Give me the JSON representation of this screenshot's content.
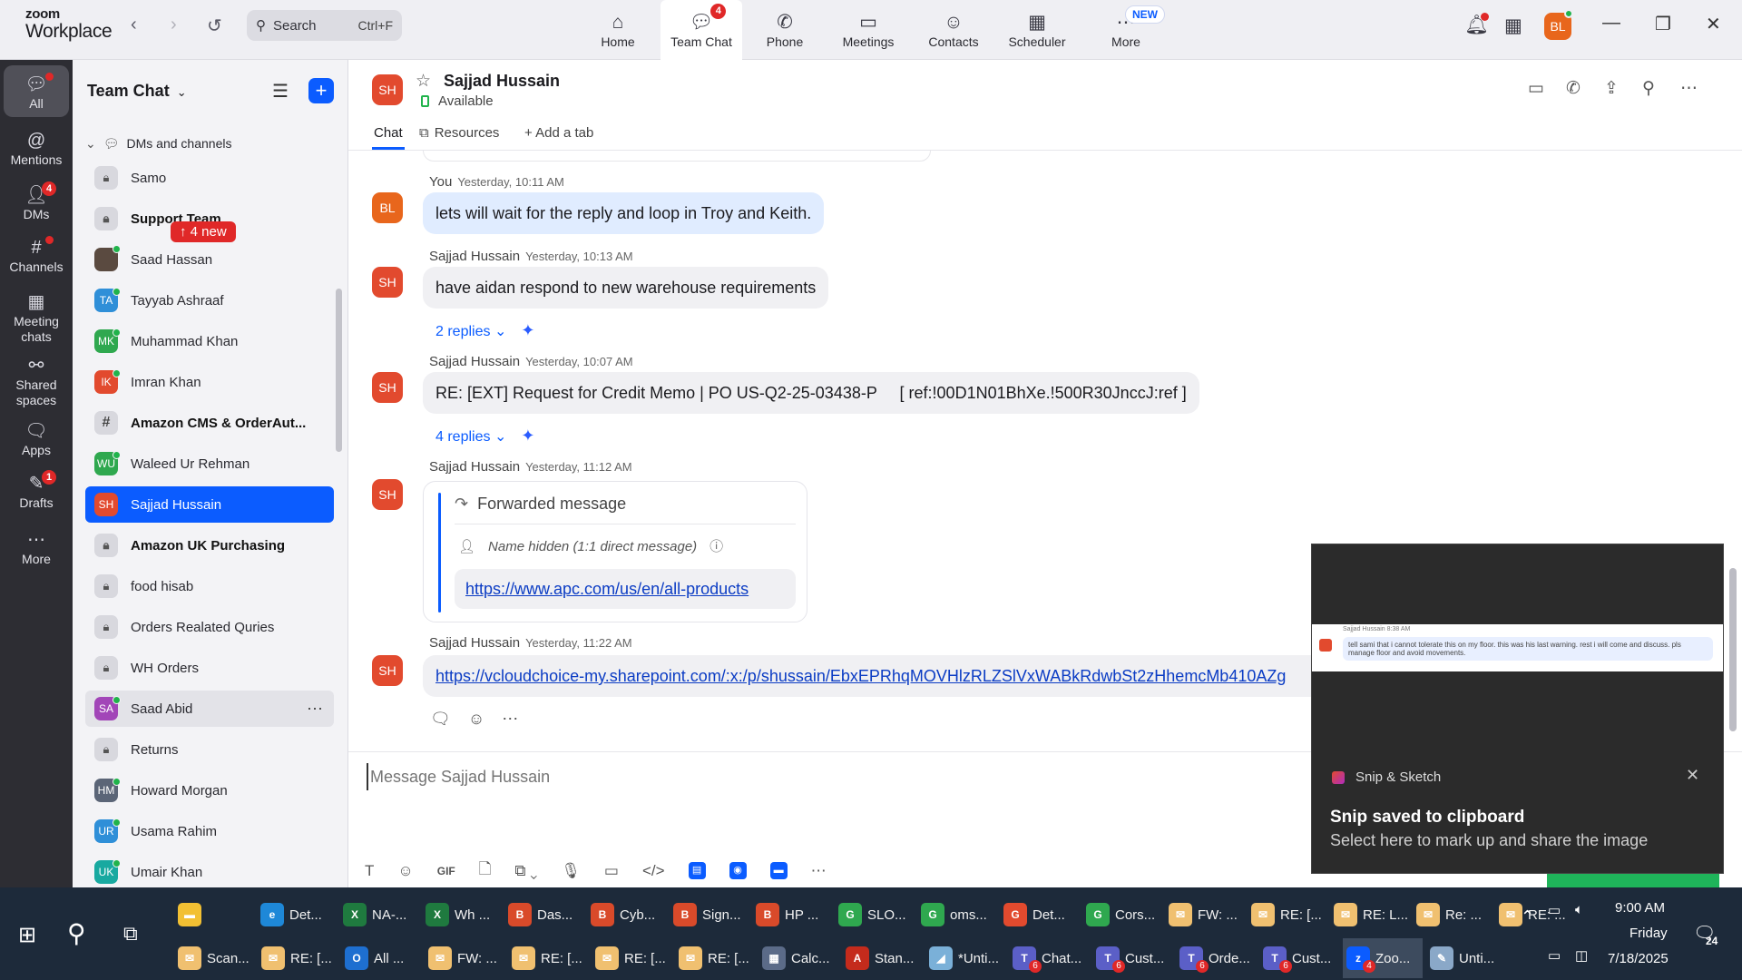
{
  "brand": {
    "line1": "zoom",
    "line2": "Workplace"
  },
  "search": {
    "label": "Search",
    "shortcut": "Ctrl+F"
  },
  "main_tabs": [
    {
      "label": "Home",
      "icon": "home-icon"
    },
    {
      "label": "Team Chat",
      "icon": "chat-icon",
      "badge": "4"
    },
    {
      "label": "Phone",
      "icon": "phone-icon"
    },
    {
      "label": "Meetings",
      "icon": "video-icon"
    },
    {
      "label": "Contacts",
      "icon": "contacts-icon"
    },
    {
      "label": "Scheduler",
      "icon": "calendar-icon"
    },
    {
      "label": "More",
      "icon": "more-icon"
    }
  ],
  "new_pill": "NEW",
  "user_avatar": "BL",
  "rail": [
    {
      "label": "All"
    },
    {
      "label": "Mentions"
    },
    {
      "label": "DMs",
      "badge": "4"
    },
    {
      "label": "Channels"
    },
    {
      "label": "Meeting chats"
    },
    {
      "label": "Shared spaces"
    },
    {
      "label": "Apps"
    },
    {
      "label": "Drafts",
      "badge": "1"
    },
    {
      "label": "More"
    }
  ],
  "sidebar": {
    "title": "Team Chat",
    "section": "DMs and channels",
    "new_badge": "↑ 4 new",
    "items": [
      {
        "name": "Samo",
        "initials": "",
        "type": "lock"
      },
      {
        "name": "Support Team",
        "initials": "",
        "type": "lock",
        "bold": true
      },
      {
        "name": "Saad Hassan",
        "initials": "",
        "type": "photo"
      },
      {
        "name": "Tayyab Ashraaf",
        "initials": "TA",
        "color": "#2f8fd8"
      },
      {
        "name": "Muhammad Khan",
        "initials": "MK",
        "color": "#2fa84f"
      },
      {
        "name": "Imran Khan",
        "initials": "IK",
        "color": "#e24a2e"
      },
      {
        "name": "Amazon CMS & OrderAut...",
        "initials": "#",
        "type": "hash",
        "bold": true
      },
      {
        "name": "Waleed Ur Rehman",
        "initials": "WU",
        "color": "#2fa84f"
      },
      {
        "name": "Sajjad Hussain",
        "initials": "SH",
        "color": "#e24a2e",
        "selected": true
      },
      {
        "name": "Amazon UK Purchasing",
        "initials": "",
        "type": "lock",
        "bold": true
      },
      {
        "name": "food hisab",
        "initials": "",
        "type": "lock"
      },
      {
        "name": "Orders Realated Quries",
        "initials": "",
        "type": "lock"
      },
      {
        "name": "WH Orders",
        "initials": "",
        "type": "lock"
      },
      {
        "name": "Saad Abid",
        "initials": "SA",
        "color": "#a246b8",
        "hover": true
      },
      {
        "name": "Returns",
        "initials": "",
        "type": "lock"
      },
      {
        "name": "Howard Morgan",
        "initials": "HM",
        "color": "#5b6577"
      },
      {
        "name": "Usama Rahim",
        "initials": "UR",
        "color": "#2f8fd8"
      },
      {
        "name": "Umair Khan",
        "initials": "UK",
        "color": "#18a9a0"
      }
    ]
  },
  "chat": {
    "avatar": "SH",
    "name": "Sajjad Hussain",
    "status": "Available",
    "tabs": [
      "Chat",
      "Resources",
      "+ Add a tab"
    ]
  },
  "messages": [
    {
      "sender": "You",
      "time": "Yesterday, 10:11 AM",
      "avatar": "BL",
      "text": "lets will wait for the reply and loop in Troy and Keith."
    },
    {
      "sender": "Sajjad Hussain",
      "time": "Yesterday, 10:13 AM",
      "avatar": "SH",
      "text": "have aidan respond to new warehouse requirements",
      "replies": "2 replies"
    },
    {
      "sender": "Sajjad Hussain",
      "time": "Yesterday, 10:07 AM",
      "avatar": "SH",
      "text": "RE: [EXT] Request for Credit Memo | PO US-Q2-25-03438-P     [ ref:!00D1N01BhXe.!500R30JnccJ:ref ]",
      "replies": "4 replies"
    },
    {
      "sender": "Sajjad Hussain",
      "time": "Yesterday, 11:12 AM",
      "avatar": "SH",
      "forward_header": "Forwarded message",
      "forward_from": "Name hidden (1:1 direct message)",
      "forward_link": "https://www.apc.com/us/en/all-products"
    },
    {
      "sender": "Sajjad Hussain",
      "time": "Yesterday, 11:22 AM",
      "avatar": "SH",
      "text": "https://vcloudchoice-my.sharepoint.com/:x:/p/shussain/EbxEPRhqMOVHlzRLZSlVxWABkRdwbSt2zHhemcMb410AZg"
    }
  ],
  "composer": {
    "placeholder": "Message Sajjad Hussain",
    "gif": "GIF"
  },
  "snip": {
    "app": "Snip & Sketch",
    "title": "Snip saved to clipboard",
    "subtitle": "Select here to mark up and share the image",
    "preview_meta": "Sajjad Hussain  8:38 AM",
    "preview_text": "tell sami that i cannot tolerate this on my floor. this was his last warning. rest i will come and discuss. pls manage floor and avoid movements."
  },
  "taskbar": {
    "row1": [
      {
        "label": "",
        "color": "#f2c033",
        "glyph": "▬"
      },
      {
        "label": "Det...",
        "color": "#1e88d8",
        "glyph": "e"
      },
      {
        "label": "NA-...",
        "color": "#1f7a3f",
        "glyph": "X"
      },
      {
        "label": "Wh ...",
        "color": "#1f7a3f",
        "glyph": "X"
      },
      {
        "label": "Das...",
        "color": "#d94a2a",
        "glyph": "B"
      },
      {
        "label": "Cyb...",
        "color": "#d94a2a",
        "glyph": "B"
      },
      {
        "label": "Sign...",
        "color": "#d94a2a",
        "glyph": "B"
      },
      {
        "label": "HP ...",
        "color": "#d94a2a",
        "glyph": "B"
      },
      {
        "label": "SLO...",
        "color": "#2fa84f",
        "glyph": "G"
      },
      {
        "label": "oms...",
        "color": "#2fa84f",
        "glyph": "G"
      },
      {
        "label": "Det...",
        "color": "#e24a2e",
        "glyph": "G"
      },
      {
        "label": "Cors...",
        "color": "#2fa84f",
        "glyph": "G"
      },
      {
        "label": "FW: ...",
        "color": "#f0c070",
        "glyph": "✉"
      },
      {
        "label": "RE: [...",
        "color": "#f0c070",
        "glyph": "✉"
      },
      {
        "label": "RE: L...",
        "color": "#f0c070",
        "glyph": "✉"
      },
      {
        "label": "Re: ...",
        "color": "#f0c070",
        "glyph": "✉"
      },
      {
        "label": "RE: ...",
        "color": "#f0c070",
        "glyph": "✉"
      }
    ],
    "row2": [
      {
        "label": "Scan...",
        "color": "#f0c070",
        "glyph": "✉"
      },
      {
        "label": "RE: [...",
        "color": "#f0c070",
        "glyph": "✉"
      },
      {
        "label": "All ...",
        "color": "#1e6fd0",
        "glyph": "O"
      },
      {
        "label": "FW: ...",
        "color": "#f0c070",
        "glyph": "✉"
      },
      {
        "label": "RE: [...",
        "color": "#f0c070",
        "glyph": "✉"
      },
      {
        "label": "RE: [...",
        "color": "#f0c070",
        "glyph": "✉"
      },
      {
        "label": "RE: [...",
        "color": "#f0c070",
        "glyph": "✉"
      },
      {
        "label": "Calc...",
        "color": "#5b6b88",
        "glyph": "▦"
      },
      {
        "label": "Stan...",
        "color": "#c42b1c",
        "glyph": "A"
      },
      {
        "label": "*Unti...",
        "color": "#7ab0d8",
        "glyph": "◢"
      },
      {
        "label": "Chat...",
        "color": "#5b5fc7",
        "glyph": "T",
        "badge": "6"
      },
      {
        "label": "Cust...",
        "color": "#5b5fc7",
        "glyph": "T",
        "badge": "6"
      },
      {
        "label": "Orde...",
        "color": "#5b5fc7",
        "glyph": "T",
        "badge": "6"
      },
      {
        "label": "Cust...",
        "color": "#5b5fc7",
        "glyph": "T",
        "badge": "6"
      },
      {
        "label": "Zoo...",
        "color": "#0b5cff",
        "glyph": "z",
        "badge": "4",
        "active": true
      },
      {
        "label": "Unti...",
        "color": "#8aa8c8",
        "glyph": "✎"
      }
    ],
    "time": "9:00 AM",
    "day": "Friday",
    "date": "7/18/2025",
    "notif": "24"
  }
}
